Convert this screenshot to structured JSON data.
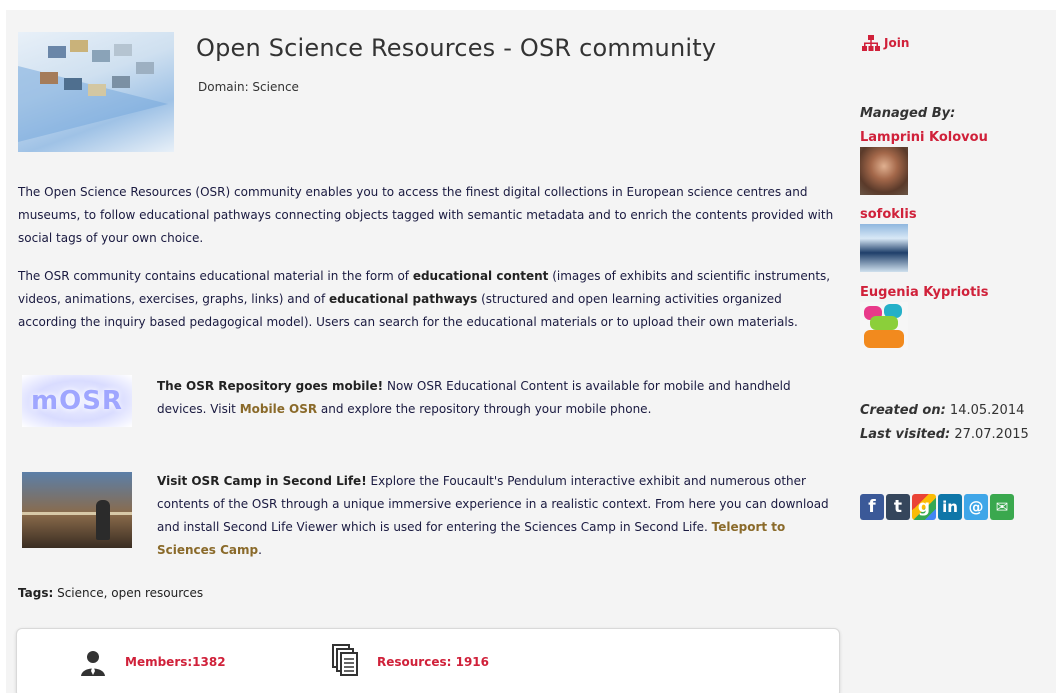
{
  "community": {
    "title": "Open Science Resources - OSR community",
    "domain": "Domain: Science"
  },
  "description": {
    "p1": "The Open Science Resources (OSR) community enables you to access the finest digital collections in European science centres and museums, to follow educational pathways connecting objects tagged with semantic metadata and to enrich the contents provided with social tags of your own choice.",
    "p2_a": "The OSR community contains educational material in the form of ",
    "p2_b": "educational content",
    "p2_c": " (images of exhibits and scientific instruments, videos, animations, exercises, graphs, links) and of ",
    "p2_d": "educational pathways",
    "p2_e": " (structured and open learning activities organized according the inquiry based pedagogical model). Users can search for the educational materials or to upload their own materials."
  },
  "promo_mobile": {
    "image_text": "mOSR",
    "headline": "The OSR Repository goes mobile!",
    "text_a": " Now OSR Educational Content is available for mobile and handheld devices. Visit ",
    "link": "Mobile OSR",
    "text_b": " and explore the repository through your mobile phone."
  },
  "promo_camp": {
    "headline": "Visit OSR Camp in Second Life!",
    "text_a": " Explore the Foucault's Pendulum interactive exhibit and numerous other contents of the OSR through a unique immersive experience in a realistic context. From here you can download and install Second Life Viewer which is used for entering the Sciences Camp in Second Life. ",
    "link": "Teleport to Sciences Camp",
    "text_b": "."
  },
  "tags": {
    "label": "Tags:",
    "value": " Science, open resources"
  },
  "stats": {
    "members": "Members:1382",
    "resources": "Resources: 1916"
  },
  "sidebar": {
    "join": "Join",
    "managed_by": "Managed By:",
    "managers": [
      {
        "name": "Lamprini Kolovou"
      },
      {
        "name": "sofoklis"
      },
      {
        "name": "Eugenia Kypriotis"
      }
    ],
    "created_label": "Created on:",
    "created_value": " 14.05.2014",
    "visited_label": "Last visited:",
    "visited_value": " 27.07.2015"
  },
  "social": [
    {
      "icon": "facebook-icon",
      "glyph": "f",
      "color": "#3b5998"
    },
    {
      "icon": "tumblr-icon",
      "glyph": "t",
      "color": "#35465c"
    },
    {
      "icon": "google-icon",
      "glyph": "g",
      "color": "#2a75f3"
    },
    {
      "icon": "linkedin-icon",
      "glyph": "in",
      "color": "#0e76a8"
    },
    {
      "icon": "email-at-icon",
      "glyph": "@",
      "color": "#3fa6e8"
    },
    {
      "icon": "mail-envelope-icon",
      "glyph": "✉",
      "color": "#3aa84e"
    }
  ],
  "colors": {
    "accent": "#d0213a",
    "link": "#8a6a2a",
    "panel": "#f4f4f4"
  }
}
